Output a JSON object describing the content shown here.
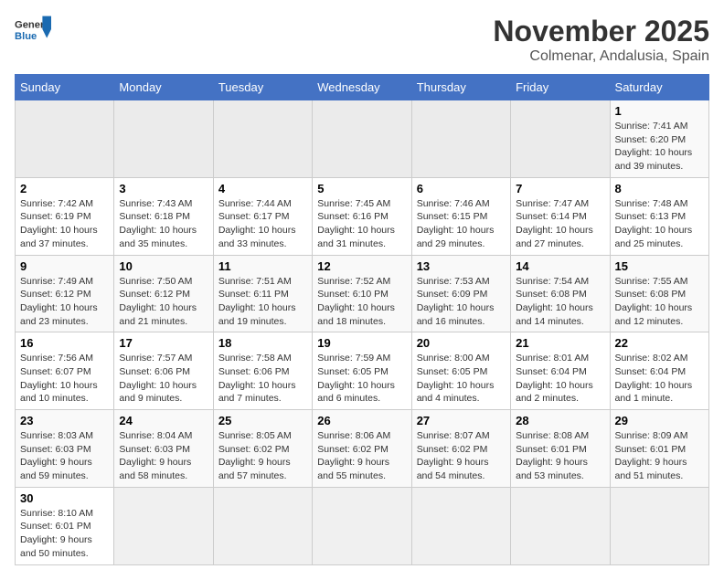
{
  "header": {
    "logo_general": "General",
    "logo_blue": "Blue",
    "month_year": "November 2025",
    "location": "Colmenar, Andalusia, Spain"
  },
  "weekdays": [
    "Sunday",
    "Monday",
    "Tuesday",
    "Wednesday",
    "Thursday",
    "Friday",
    "Saturday"
  ],
  "weeks": [
    [
      {
        "day": "",
        "info": ""
      },
      {
        "day": "",
        "info": ""
      },
      {
        "day": "",
        "info": ""
      },
      {
        "day": "",
        "info": ""
      },
      {
        "day": "",
        "info": ""
      },
      {
        "day": "",
        "info": ""
      },
      {
        "day": "1",
        "info": "Sunrise: 7:41 AM\nSunset: 6:20 PM\nDaylight: 10 hours and 39 minutes."
      }
    ],
    [
      {
        "day": "2",
        "info": "Sunrise: 7:42 AM\nSunset: 6:19 PM\nDaylight: 10 hours and 37 minutes."
      },
      {
        "day": "3",
        "info": "Sunrise: 7:43 AM\nSunset: 6:18 PM\nDaylight: 10 hours and 35 minutes."
      },
      {
        "day": "4",
        "info": "Sunrise: 7:44 AM\nSunset: 6:17 PM\nDaylight: 10 hours and 33 minutes."
      },
      {
        "day": "5",
        "info": "Sunrise: 7:45 AM\nSunset: 6:16 PM\nDaylight: 10 hours and 31 minutes."
      },
      {
        "day": "6",
        "info": "Sunrise: 7:46 AM\nSunset: 6:15 PM\nDaylight: 10 hours and 29 minutes."
      },
      {
        "day": "7",
        "info": "Sunrise: 7:47 AM\nSunset: 6:14 PM\nDaylight: 10 hours and 27 minutes."
      },
      {
        "day": "8",
        "info": "Sunrise: 7:48 AM\nSunset: 6:13 PM\nDaylight: 10 hours and 25 minutes."
      }
    ],
    [
      {
        "day": "9",
        "info": "Sunrise: 7:49 AM\nSunset: 6:12 PM\nDaylight: 10 hours and 23 minutes."
      },
      {
        "day": "10",
        "info": "Sunrise: 7:50 AM\nSunset: 6:12 PM\nDaylight: 10 hours and 21 minutes."
      },
      {
        "day": "11",
        "info": "Sunrise: 7:51 AM\nSunset: 6:11 PM\nDaylight: 10 hours and 19 minutes."
      },
      {
        "day": "12",
        "info": "Sunrise: 7:52 AM\nSunset: 6:10 PM\nDaylight: 10 hours and 18 minutes."
      },
      {
        "day": "13",
        "info": "Sunrise: 7:53 AM\nSunset: 6:09 PM\nDaylight: 10 hours and 16 minutes."
      },
      {
        "day": "14",
        "info": "Sunrise: 7:54 AM\nSunset: 6:08 PM\nDaylight: 10 hours and 14 minutes."
      },
      {
        "day": "15",
        "info": "Sunrise: 7:55 AM\nSunset: 6:08 PM\nDaylight: 10 hours and 12 minutes."
      }
    ],
    [
      {
        "day": "16",
        "info": "Sunrise: 7:56 AM\nSunset: 6:07 PM\nDaylight: 10 hours and 10 minutes."
      },
      {
        "day": "17",
        "info": "Sunrise: 7:57 AM\nSunset: 6:06 PM\nDaylight: 10 hours and 9 minutes."
      },
      {
        "day": "18",
        "info": "Sunrise: 7:58 AM\nSunset: 6:06 PM\nDaylight: 10 hours and 7 minutes."
      },
      {
        "day": "19",
        "info": "Sunrise: 7:59 AM\nSunset: 6:05 PM\nDaylight: 10 hours and 6 minutes."
      },
      {
        "day": "20",
        "info": "Sunrise: 8:00 AM\nSunset: 6:05 PM\nDaylight: 10 hours and 4 minutes."
      },
      {
        "day": "21",
        "info": "Sunrise: 8:01 AM\nSunset: 6:04 PM\nDaylight: 10 hours and 2 minutes."
      },
      {
        "day": "22",
        "info": "Sunrise: 8:02 AM\nSunset: 6:04 PM\nDaylight: 10 hours and 1 minute."
      }
    ],
    [
      {
        "day": "23",
        "info": "Sunrise: 8:03 AM\nSunset: 6:03 PM\nDaylight: 9 hours and 59 minutes."
      },
      {
        "day": "24",
        "info": "Sunrise: 8:04 AM\nSunset: 6:03 PM\nDaylight: 9 hours and 58 minutes."
      },
      {
        "day": "25",
        "info": "Sunrise: 8:05 AM\nSunset: 6:02 PM\nDaylight: 9 hours and 57 minutes."
      },
      {
        "day": "26",
        "info": "Sunrise: 8:06 AM\nSunset: 6:02 PM\nDaylight: 9 hours and 55 minutes."
      },
      {
        "day": "27",
        "info": "Sunrise: 8:07 AM\nSunset: 6:02 PM\nDaylight: 9 hours and 54 minutes."
      },
      {
        "day": "28",
        "info": "Sunrise: 8:08 AM\nSunset: 6:01 PM\nDaylight: 9 hours and 53 minutes."
      },
      {
        "day": "29",
        "info": "Sunrise: 8:09 AM\nSunset: 6:01 PM\nDaylight: 9 hours and 51 minutes."
      }
    ],
    [
      {
        "day": "30",
        "info": "Sunrise: 8:10 AM\nSunset: 6:01 PM\nDaylight: 9 hours and 50 minutes."
      },
      {
        "day": "",
        "info": ""
      },
      {
        "day": "",
        "info": ""
      },
      {
        "day": "",
        "info": ""
      },
      {
        "day": "",
        "info": ""
      },
      {
        "day": "",
        "info": ""
      },
      {
        "day": "",
        "info": ""
      }
    ]
  ]
}
